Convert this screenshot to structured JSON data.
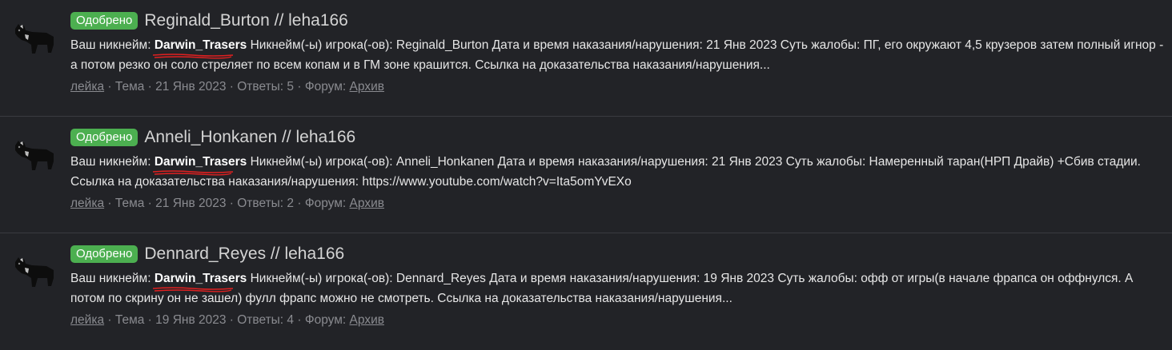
{
  "threads": [
    {
      "badge": "Одобрено",
      "title": "Reginald_Burton // leha166",
      "snippet_prefix": "Ваш никнейм: ",
      "nickname": "Darwin_Trasers",
      "snippet_rest": " Никнейм(-ы) игрока(-ов): Reginald_Burton Дата и время наказания/нарушения: 21 Янв 2023 Суть жалобы: ПГ, его окружают 4,5 крузеров затем полный игнор - а потом резко он соло стреляет по всем копам и в ГМ зоне крашится. Ссылка на доказательства наказания/нарушения...",
      "author": "лейка",
      "type": "Тема",
      "date": "21 Янв 2023",
      "replies": "Ответы: 5",
      "forum_label": "Форум:",
      "forum": "Архив"
    },
    {
      "badge": "Одобрено",
      "title": "Anneli_Honkanen // leha166",
      "snippet_prefix": "Ваш никнейм: ",
      "nickname": "Darwin_Trasers",
      "snippet_rest": " Никнейм(-ы) игрока(-ов): Anneli_Honkanen Дата и время наказания/нарушения: 21 Янв 2023 Суть жалобы: Намеренный таран(НРП Драйв) +Сбив стадии. Ссылка на доказательства наказания/нарушения: https://www.youtube.com/watch?v=Ita5omYvEXo",
      "author": "лейка",
      "type": "Тема",
      "date": "21 Янв 2023",
      "replies": "Ответы: 2",
      "forum_label": "Форум:",
      "forum": "Архив"
    },
    {
      "badge": "Одобрено",
      "title": "Dennard_Reyes // leha166",
      "snippet_prefix": "Ваш никнейм: ",
      "nickname": "Darwin_Trasers",
      "snippet_rest": " Никнейм(-ы) игрока(-ов): Dennard_Reyes Дата и время наказания/нарушения: 19 Янв 2023 Суть жалобы: офф от игры(в начале фрапса он оффнулся. А потом по скрину он не зашел) фулл фрапс можно не смотреть. Ссылка на доказательства наказания/нарушения...",
      "author": "лейка",
      "type": "Тема",
      "date": "19 Янв 2023",
      "replies": "Ответы: 4",
      "forum_label": "Форум:",
      "forum": "Архив"
    }
  ],
  "separator": " · ",
  "colors": {
    "badge": "#4caf50",
    "background": "#222327",
    "scribble": "#e02020"
  },
  "icons": {
    "avatar": "black-dog-avatar"
  }
}
